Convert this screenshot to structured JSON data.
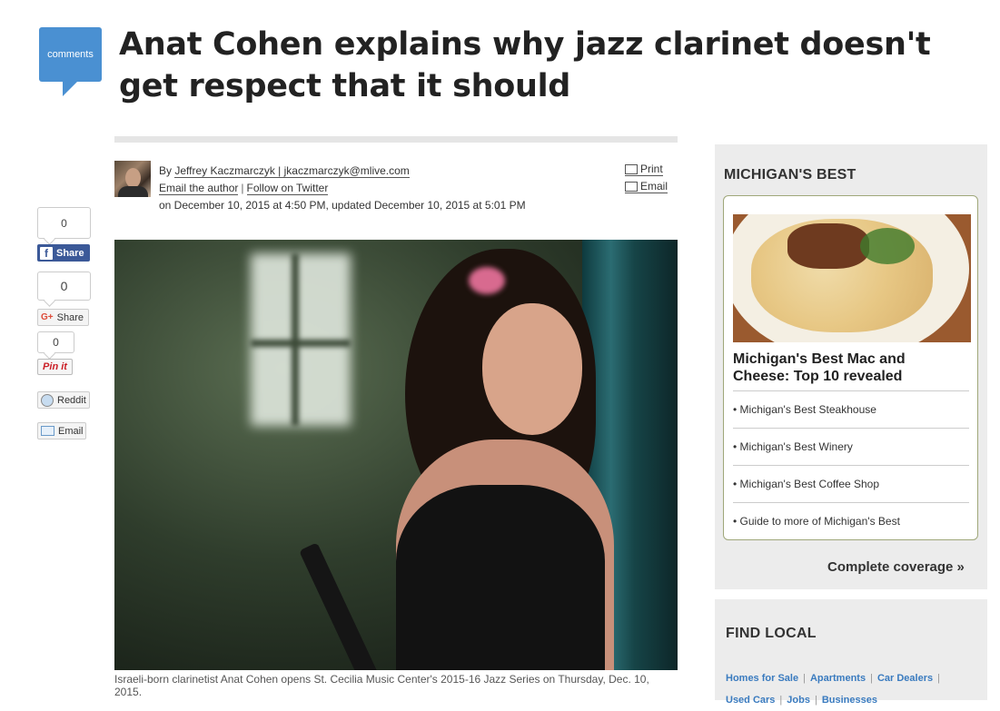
{
  "comments_label": "comments",
  "headline": "Anat Cohen explains why jazz clarinet doesn't get respect that it should",
  "byline": {
    "prefix": "By ",
    "author": "Jeffrey Kaczmarczyk | jkaczmarczyk@mlive.com",
    "email_author": "Email the author",
    "sep": "|",
    "follow": "Follow on Twitter",
    "date": "on December 10, 2015 at 4:50 PM, updated December 10, 2015 at 5:01 PM"
  },
  "tools": {
    "print": "Print",
    "email": "Email"
  },
  "share": {
    "fb_count": "0",
    "fb_label": "Share",
    "gplus_count": "0",
    "gplus_label": "Share",
    "pin_count": "0",
    "pin_label": "Pin it",
    "reddit_label": "Reddit",
    "email_label": "Email"
  },
  "caption": "Israeli-born clarinetist Anat Cohen opens St. Cecilia Music Center's 2015-16 Jazz Series on Thursday, Dec. 10, 2015.",
  "sidebar": {
    "title": "MICHIGAN'S BEST",
    "card_headline": "Michigan's Best Mac and Cheese: Top 10 revealed",
    "items": [
      "• Michigan's Best Steakhouse",
      "• Michigan's Best Winery",
      "• Michigan's Best Coffee Shop",
      "• Guide to more of Michigan's Best"
    ],
    "complete": "Complete coverage »"
  },
  "find_local": {
    "title": "FIND LOCAL",
    "links": [
      "Homes for Sale",
      "Apartments",
      "Car Dealers",
      "Used Cars",
      "Jobs",
      "Businesses"
    ]
  }
}
